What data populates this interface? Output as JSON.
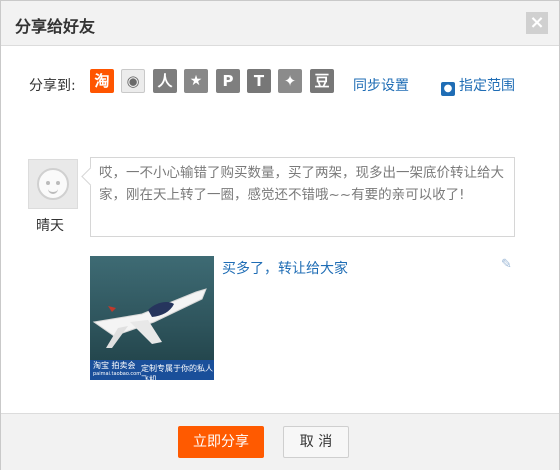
{
  "dialog": {
    "title": "分享给好友",
    "close_label": "×"
  },
  "share": {
    "label": "分享到:",
    "icons": [
      {
        "name": "taobao",
        "glyph": "淘"
      },
      {
        "name": "sina-weibo",
        "glyph": "◉"
      },
      {
        "name": "renren",
        "glyph": "人"
      },
      {
        "name": "kaixin",
        "glyph": "★"
      },
      {
        "name": "pinterest",
        "glyph": "P"
      },
      {
        "name": "tieba",
        "glyph": "T"
      },
      {
        "name": "qzone",
        "glyph": "✦"
      },
      {
        "name": "douban",
        "glyph": "豆"
      }
    ],
    "sync_label": "同步设置",
    "scope_label": "指定范围"
  },
  "user": {
    "name": "晴天"
  },
  "message": "哎，一不小心输错了购买数量，买了两架，现多出一架底价转让给大家，刚在天上转了一圈，感觉还不错哦~~有要的亲可以收了!",
  "item": {
    "title": "买多了，转让给大家",
    "thumb_text_left": "淘宝 拍卖会",
    "thumb_text_left_sub": "paimai.taobao.com",
    "thumb_text_right": "定制专属于你的私人飞机"
  },
  "footer": {
    "share_label": "立即分享",
    "cancel_label": "取 消"
  },
  "colors": {
    "accent": "#ff5a00",
    "link": "#1f6db5"
  }
}
